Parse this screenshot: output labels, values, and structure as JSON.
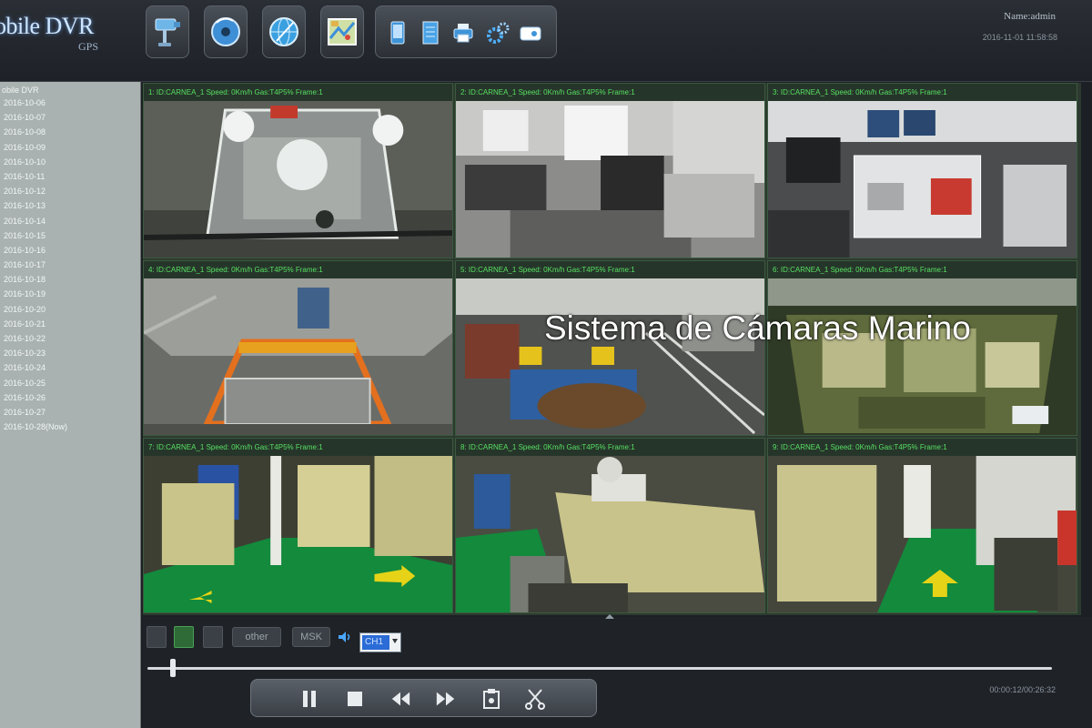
{
  "header": {
    "logo_text": "obile DVR",
    "logo_sub": "GPS",
    "user_name": "Name:admin",
    "datetime": "2016-11-01 11:58:58"
  },
  "toolbar": {
    "main_icons": [
      "camera-icon",
      "playback-disc-icon",
      "gps-globe-icon",
      "map-icon"
    ],
    "group_icons": [
      "phone-icon",
      "document-icon",
      "printer-icon",
      "settings-icon",
      "disk-icon"
    ]
  },
  "sidebar": {
    "root": "obile DVR",
    "items": [
      "2016-10-06",
      "2016-10-07",
      "2016-10-08",
      "2016-10-09",
      "2016-10-10",
      "2016-10-11",
      "2016-10-12",
      "2016-10-13",
      "2016-10-14",
      "2016-10-15",
      "2016-10-16",
      "2016-10-17",
      "2016-10-18",
      "2016-10-19",
      "2016-10-20",
      "2016-10-21",
      "2016-10-22",
      "2016-10-23",
      "2016-10-24",
      "2016-10-25",
      "2016-10-26",
      "2016-10-27",
      "2016-10-28(Now)"
    ]
  },
  "tiles": [
    {
      "label": "1: ID:CARNEA_1 Speed: 0Km/h Gas:T4P5% Frame:1"
    },
    {
      "label": "2: ID:CARNEA_1 Speed: 0Km/h Gas:T4P5% Frame:1"
    },
    {
      "label": "3: ID:CARNEA_1 Speed: 0Km/h Gas:T4P5% Frame:1"
    },
    {
      "label": "4: ID:CARNEA_1 Speed: 0Km/h Gas:T4P5% Frame:1"
    },
    {
      "label": "5: ID:CARNEA_1 Speed: 0Km/h Gas:T4P5% Frame:1"
    },
    {
      "label": "6: ID:CARNEA_1 Speed: 0Km/h Gas:T4P5% Frame:1"
    },
    {
      "label": "7: ID:CARNEA_1 Speed: 0Km/h Gas:T4P5% Frame:1"
    },
    {
      "label": "8: ID:CARNEA_1 Speed: 0Km/h Gas:T4P5% Frame:1"
    },
    {
      "label": "9: ID:CARNEA_1 Speed: 0Km/h Gas:T4P5% Frame:1"
    }
  ],
  "watermark": "Sistema de Cámaras Marino",
  "controls": {
    "other_label": "other",
    "msk_label": "MSK",
    "channel_value": "CH1",
    "playback_time": "00:00:12/00:26:32",
    "progress_fraction": 0.028,
    "transport_icons": [
      "pause-icon",
      "stop-icon",
      "rewind-icon",
      "fast-forward-icon",
      "snapshot-icon",
      "clip-cut-icon"
    ]
  },
  "colors": {
    "accent_green": "#57e062",
    "sidebar_bg": "#a9b2b0",
    "select_highlight": "#2b6cd6"
  }
}
